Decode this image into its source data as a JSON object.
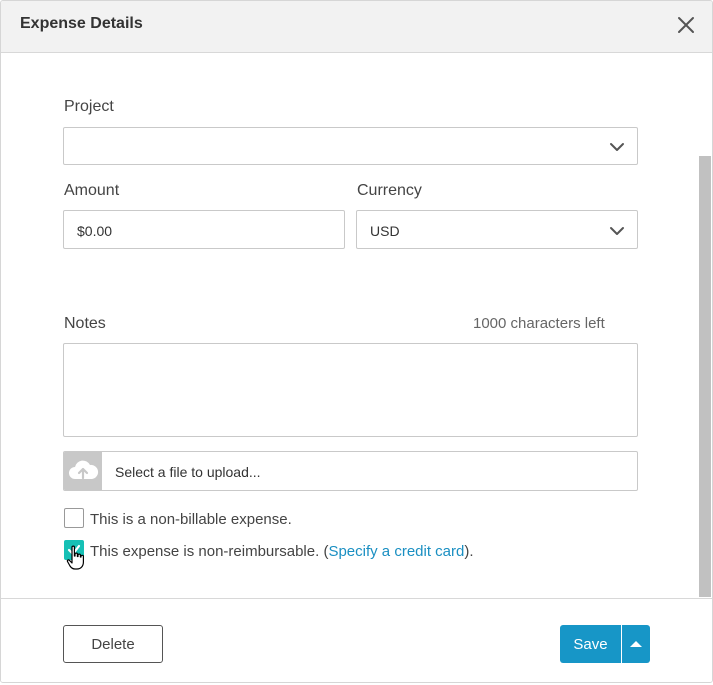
{
  "dialog": {
    "title": "Expense Details"
  },
  "form": {
    "project": {
      "label": "Project",
      "value": ""
    },
    "amount": {
      "label": "Amount",
      "value": "$0.00"
    },
    "currency": {
      "label": "Currency",
      "value": "USD"
    },
    "notes": {
      "label": "Notes",
      "counter": "1000 characters left",
      "value": ""
    },
    "upload": {
      "placeholder": "Select a file to upload..."
    },
    "non_billable": {
      "label": "This is a non-billable expense.",
      "checked": false
    },
    "non_reimbursable": {
      "label_prefix": "This expense is non-reimbursable. (",
      "link": "Specify a credit card",
      "label_suffix": ").",
      "checked": true
    }
  },
  "footer": {
    "delete_label": "Delete",
    "save_label": "Save"
  },
  "colors": {
    "accent": "#1796c7",
    "checkbox_checked": "#16c0b5",
    "link": "#1a8fc2"
  }
}
